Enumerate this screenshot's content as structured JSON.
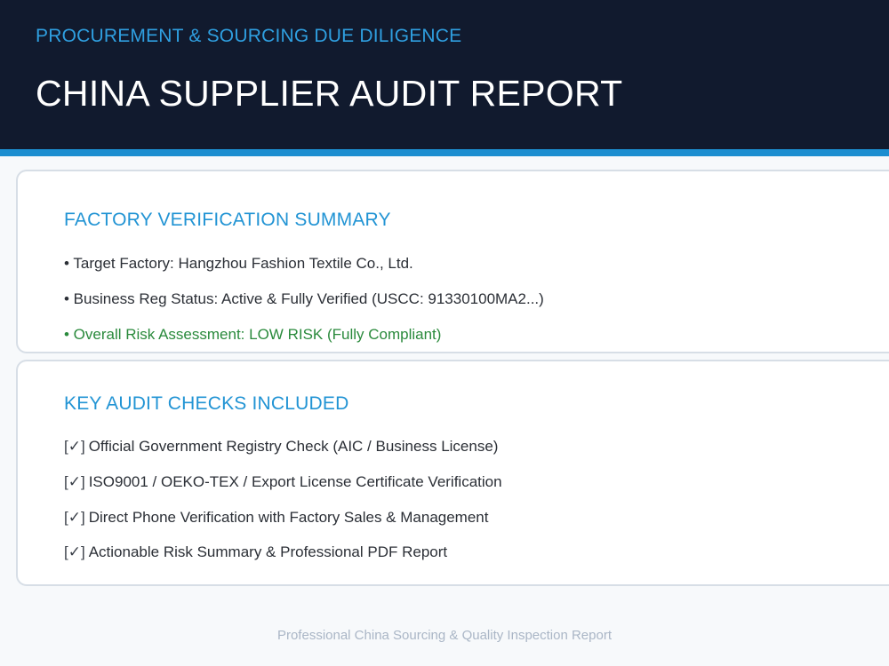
{
  "header": {
    "kicker": "PROCUREMENT & SOURCING DUE DILIGENCE",
    "title": "CHINA SUPPLIER AUDIT REPORT"
  },
  "summary": {
    "heading": "FACTORY VERIFICATION SUMMARY",
    "items": [
      "• Target Factory: Hangzhou Fashion Textile Co., Ltd.",
      "• Business Reg Status: Active & Fully Verified (USCC: 91330100MA2...)",
      "• Overall Risk Assessment: LOW RISK (Fully Compliant)"
    ],
    "highlight_color": "#2a8a3c"
  },
  "checks": {
    "heading": "KEY AUDIT CHECKS INCLUDED",
    "checkbox_glyph": "[✓]",
    "items": [
      "Official Government Registry Check (AIC / Business License)",
      "ISO9001 / OEKO-TEX / Export License Certificate Verification",
      "Direct Phone Verification with Factory Sales & Management",
      "Actionable Risk Summary & Professional PDF Report"
    ]
  },
  "footer": {
    "text": "Professional China Sourcing & Quality Inspection Report"
  },
  "colors": {
    "header_bg": "#111a2e",
    "accent": "#1c8ed0",
    "heading": "#2294d4"
  }
}
